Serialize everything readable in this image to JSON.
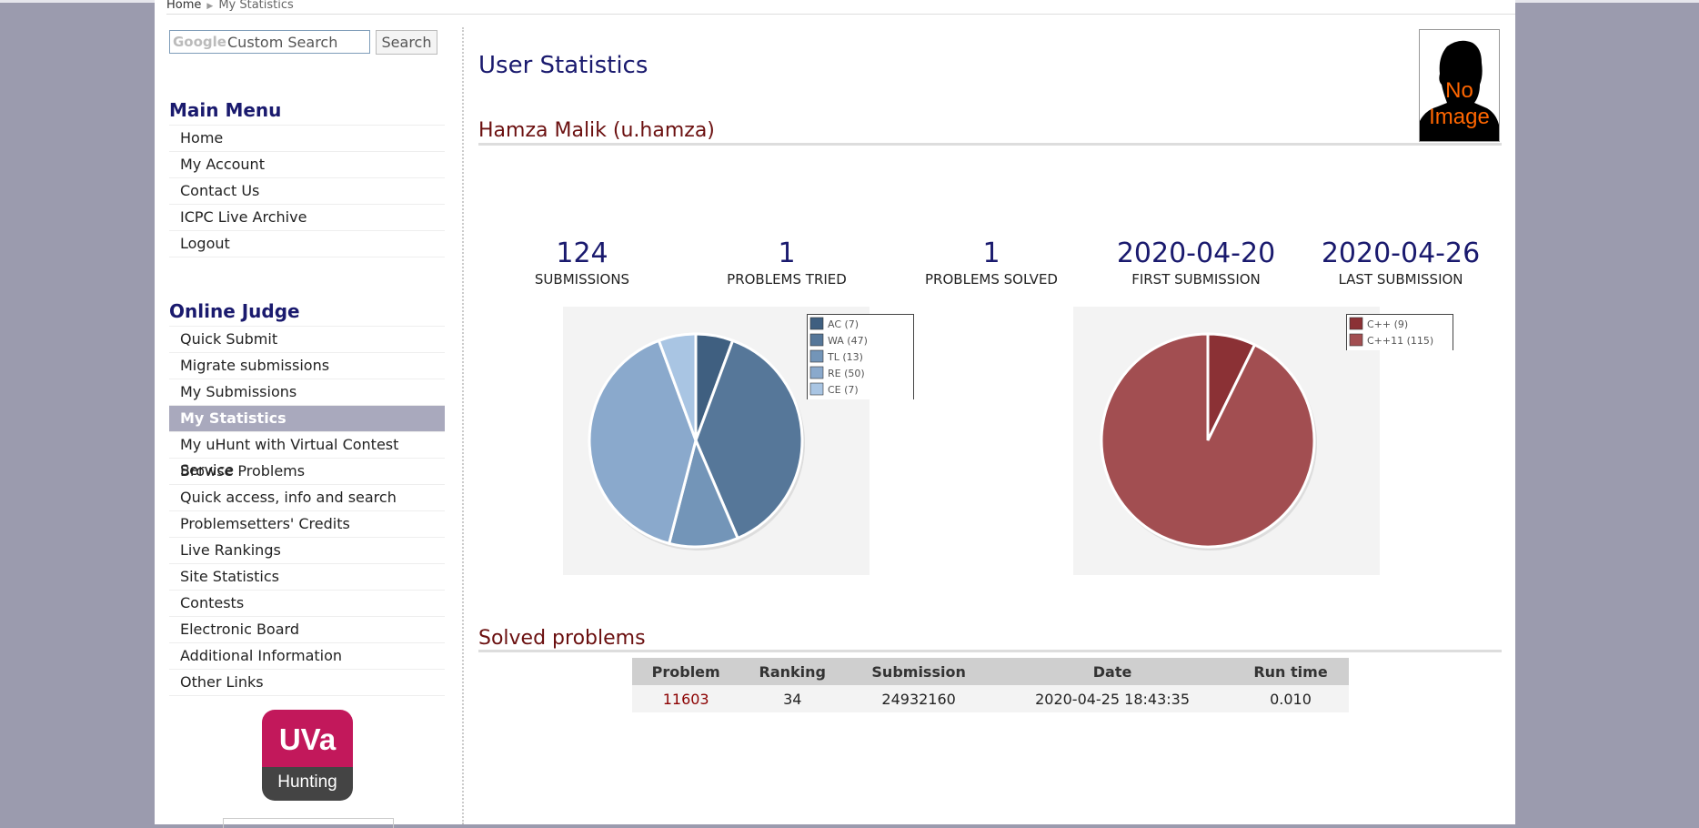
{
  "breadcrumb": {
    "home": "Home",
    "current": "My Statistics"
  },
  "search": {
    "logo": "Google",
    "placeholder": "Custom Search",
    "button": "Search"
  },
  "main_menu": {
    "title": "Main Menu",
    "items": [
      "Home",
      "My Account",
      "Contact Us",
      "ICPC Live Archive",
      "Logout"
    ]
  },
  "online_judge": {
    "title": "Online Judge",
    "items": [
      "Quick Submit",
      "Migrate submissions",
      "My Submissions",
      "My Statistics",
      "My uHunt with Virtual Contest Service",
      "Browse Problems",
      "Quick access, info and search",
      "Problemsetters' Credits",
      "Live Rankings",
      "Site Statistics",
      "Contests",
      "Electronic Board",
      "Additional Information",
      "Other Links"
    ],
    "active_item": "My Statistics"
  },
  "logo": {
    "top": "UVa",
    "bottom": "Hunting"
  },
  "page": {
    "title": "User Statistics",
    "user": "Hamza Malik (u.hamza)",
    "avatar_text": "No Image"
  },
  "stats": [
    {
      "value": "124",
      "label": "SUBMISSIONS"
    },
    {
      "value": "1",
      "label": "PROBLEMS TRIED"
    },
    {
      "value": "1",
      "label": "PROBLEMS SOLVED"
    },
    {
      "value": "2020-04-20",
      "label": "FIRST SUBMISSION"
    },
    {
      "value": "2020-04-26",
      "label": "LAST SUBMISSION"
    }
  ],
  "chart_data": [
    {
      "type": "pie",
      "categories": [
        "AC (7)",
        "WA (47)",
        "TL (13)",
        "RE (50)",
        "CE (7)"
      ],
      "values": [
        7,
        47,
        13,
        50,
        7
      ],
      "colors": [
        "#3f5f80",
        "#567799",
        "#7395b8",
        "#8aa9cc",
        "#a9c5e3"
      ],
      "legend": "top-right"
    },
    {
      "type": "pie",
      "categories": [
        "C++ (9)",
        "C++11 (115)"
      ],
      "values": [
        9,
        115
      ],
      "colors": [
        "#8b3135",
        "#a24e51"
      ],
      "legend": "top-right"
    }
  ],
  "solved": {
    "title": "Solved problems",
    "headers": [
      "Problem",
      "Ranking",
      "Submission",
      "Date",
      "Run time"
    ],
    "rows": [
      [
        "11603",
        "34",
        "24932160",
        "2020-04-25 18:43:35",
        "0.010"
      ]
    ]
  }
}
